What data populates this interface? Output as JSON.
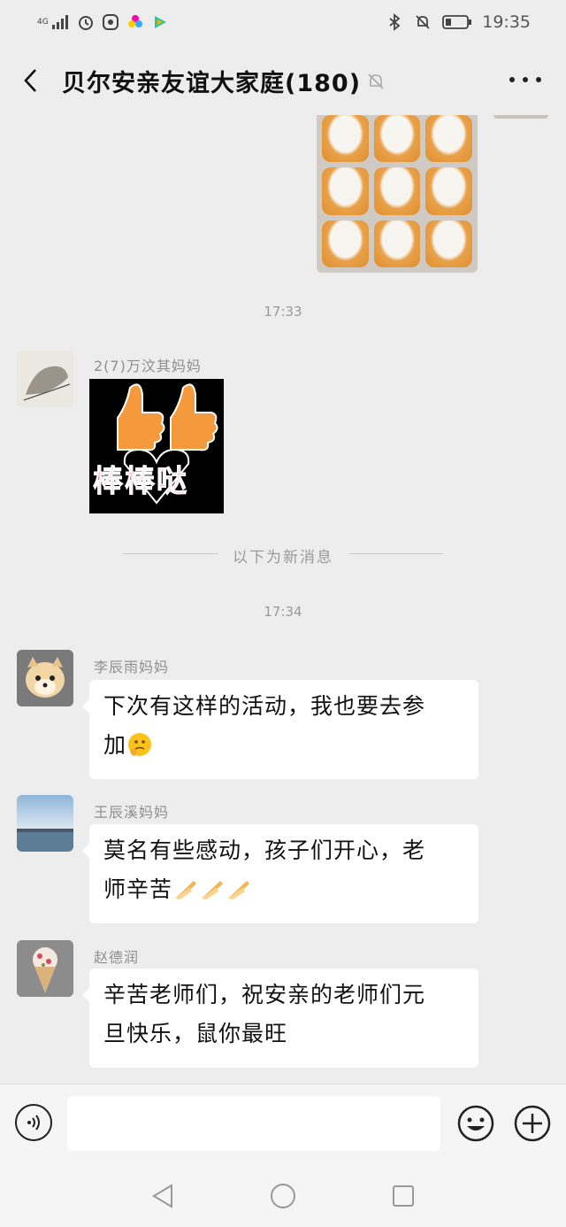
{
  "status_bar": {
    "network": "4G",
    "time": "19:35"
  },
  "header": {
    "title": "贝尔安亲友谊大家庭(180)"
  },
  "messages": {
    "time_1": "17:33",
    "sender_1": "2(7)万汶其妈妈",
    "sticker_text": "棒棒哒",
    "divider_text": "以下为新消息",
    "time_2": "17:34",
    "sender_2": "李辰雨妈妈",
    "bubble_2_line1": "下次有这样的活动，我也要去参",
    "bubble_2_line2": "加",
    "sender_3": "王辰溪妈妈",
    "bubble_3_line1": "莫名有些感动，孩子们开心，老",
    "bubble_3_line2": "师辛苦",
    "sender_4": "赵德润",
    "bubble_4_line1": "辛苦老师们，祝安亲的老师们元",
    "bubble_4_line2": "旦快乐，鼠你最旺"
  },
  "input": {
    "placeholder": ""
  },
  "colors": {
    "background": "#ededed",
    "bubble": "#ffffff",
    "muted_text": "#9a9a9a"
  },
  "icons": [
    "signal-icon",
    "alarm-icon",
    "app-icon",
    "photos-icon",
    "video-icon",
    "bluetooth-icon",
    "mute-icon",
    "battery-icon",
    "back-icon",
    "more-icon",
    "voice-icon",
    "emoji-icon",
    "plus-icon",
    "nav-back-icon",
    "nav-home-icon",
    "nav-recent-icon"
  ]
}
